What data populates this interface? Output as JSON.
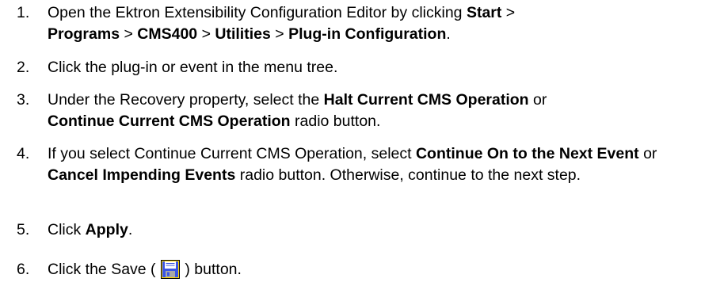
{
  "steps": [
    {
      "number": "1.",
      "t1": "Open the Ektron Extensibility Configuration Editor by clicking ",
      "b1": "Start",
      "t2": " > ",
      "b2": "Programs",
      "t3": " > ",
      "b3": "CMS400",
      "t4": " > ",
      "b4": "Utilities",
      "t5": " > ",
      "b5": "Plug-in Configuration",
      "t6": "."
    },
    {
      "number": "2.",
      "t1": "Click the plug-in or event in the menu tree."
    },
    {
      "number": "3.",
      "t1": "Under the Recovery property, select the ",
      "b1": "Halt Current CMS Operation",
      "t2": " or ",
      "b2": "Continue Current CMS Operation",
      "t3": " radio button."
    },
    {
      "number": "4.",
      "t1": "If you select Continue Current CMS Operation, select ",
      "b1": "Continue On to the Next Event",
      "t2": " or ",
      "b2": "Cancel Impending Events",
      "t3": " radio button. Otherwise, continue to the next step."
    },
    {
      "number": "5.",
      "t1": "Click ",
      "b1": "Apply",
      "t2": "."
    },
    {
      "number": "6.",
      "t1": "Click the Save ( ",
      "icon": "save-icon",
      "t2": " ) button."
    }
  ]
}
